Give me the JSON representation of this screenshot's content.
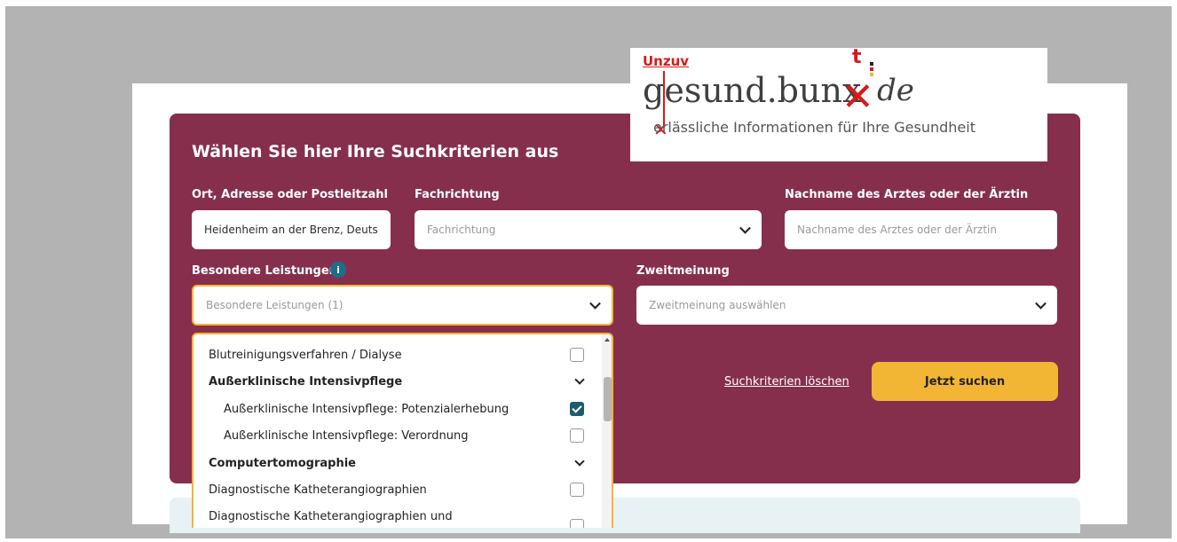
{
  "search_panel": {
    "heading": "Wählen Sie hier Ihre Suchkriterien aus",
    "location": {
      "label": "Ort, Adresse oder Postleitzahl",
      "value": "Heidenheim an der Brenz, Deuts"
    },
    "specialty": {
      "label": "Fachrichtung",
      "placeholder": "Fachrichtung"
    },
    "doctor_name": {
      "label": "Nachname des Arztes oder der Ärztin",
      "placeholder": "Nachname des Arztes oder der Ärztin"
    },
    "special_services": {
      "label": "Besondere Leistungen",
      "info": "i",
      "value": "Besondere Leistungen (1)"
    },
    "second_opinion": {
      "label": "Zweitmeinung",
      "placeholder": "Zweitmeinung auswählen"
    },
    "clear_link": "Suchkriterien löschen",
    "search_button": "Jetzt suchen"
  },
  "dropdown": {
    "items": [
      {
        "label": "Blutreinigungsverfahren / Dialyse",
        "type": "option",
        "checked": false
      },
      {
        "label": "Außerklinische Intensivpflege",
        "type": "group"
      },
      {
        "label": "Außerklinische Intensivpflege: Potenzialerhebung",
        "type": "suboption",
        "checked": true
      },
      {
        "label": "Außerklinische Intensivpflege: Verordnung",
        "type": "suboption",
        "checked": false
      },
      {
        "label": "Computertomographie",
        "type": "group"
      },
      {
        "label": "Diagnostische Katheterangiographien",
        "type": "option",
        "checked": false
      },
      {
        "label": "Diagnostische Katheterangiographien und",
        "type": "option",
        "checked": false
      }
    ]
  },
  "logo": {
    "annotation": "Unzuv",
    "correction_letter": "t",
    "main": "gesund.bunx",
    "tld": "de",
    "tagline": "erlässliche Informationen für Ihre Gesundheit"
  },
  "colors": {
    "panel": "#862f4d",
    "button": "#f3b634",
    "annotation": "#d51b1b",
    "checkbox": "#1d5c6e"
  }
}
